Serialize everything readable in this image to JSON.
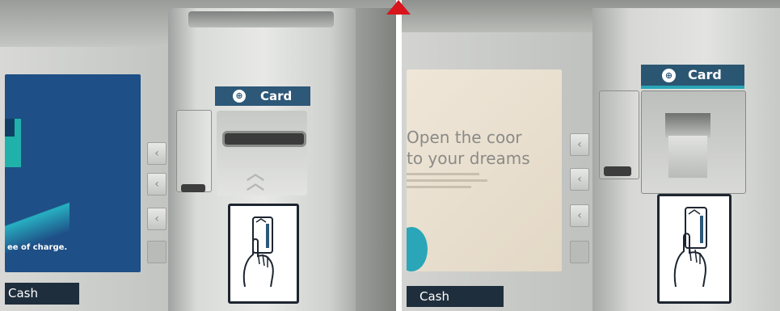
{
  "left_photo": {
    "screen_text": "ee of charge.",
    "card_label": "Card",
    "cash_label": "Cash"
  },
  "right_photo": {
    "screen_headline_1": "Open the coor",
    "screen_headline_2": "to your dreams",
    "card_label": "Card",
    "cash_label": "Cash"
  },
  "icons": {
    "arrow_key": "chevron-left",
    "insert_hint": "double-chevron-up",
    "card_instruction": "hand-holding-card"
  }
}
